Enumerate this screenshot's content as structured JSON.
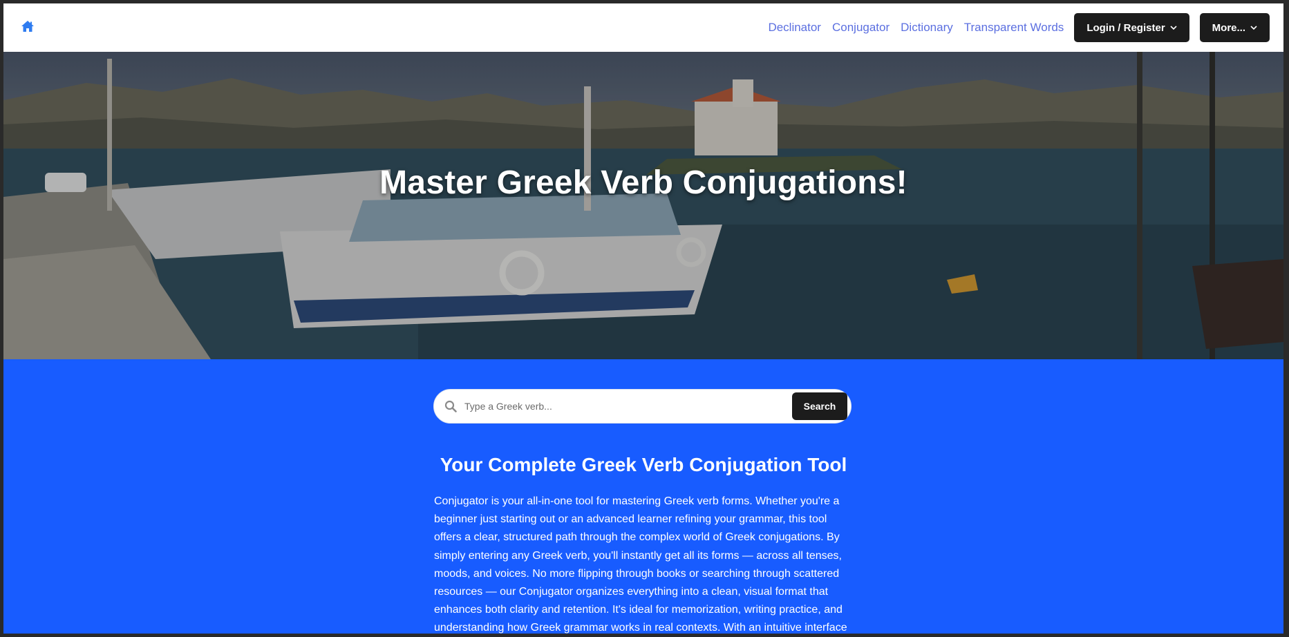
{
  "nav": {
    "home_icon": "home-icon",
    "links": [
      "Declinator",
      "Conjugator",
      "Dictionary",
      "Transparent Words"
    ],
    "login_label": "Login / Register",
    "more_label": "More...",
    "link_color": "#5b6fe0",
    "button_color": "#1c1c1c"
  },
  "hero": {
    "title": "Master Greek Verb Conjugations!"
  },
  "search": {
    "placeholder": "Type a Greek verb...",
    "button_label": "Search",
    "icon": "search-icon"
  },
  "content": {
    "heading": "Your Complete Greek Verb Conjugation Tool",
    "paragraph": "Conjugator is your all-in-one tool for mastering Greek verb forms. Whether you're a beginner just starting out or an advanced learner refining your grammar, this tool offers a clear, structured path through the complex world of Greek conjugations. By simply entering any Greek verb, you'll instantly get all its forms — across all tenses, moods, and voices. No more flipping through books or searching through scattered resources — our Conjugator organizes everything into a clean, visual format that enhances both clarity and retention. It's ideal for memorization, writing practice, and understanding how Greek grammar works in real contexts. With an intuitive interface"
  },
  "colors": {
    "accent_blue": "#185cff",
    "navbar_bg": "#ffffff"
  }
}
